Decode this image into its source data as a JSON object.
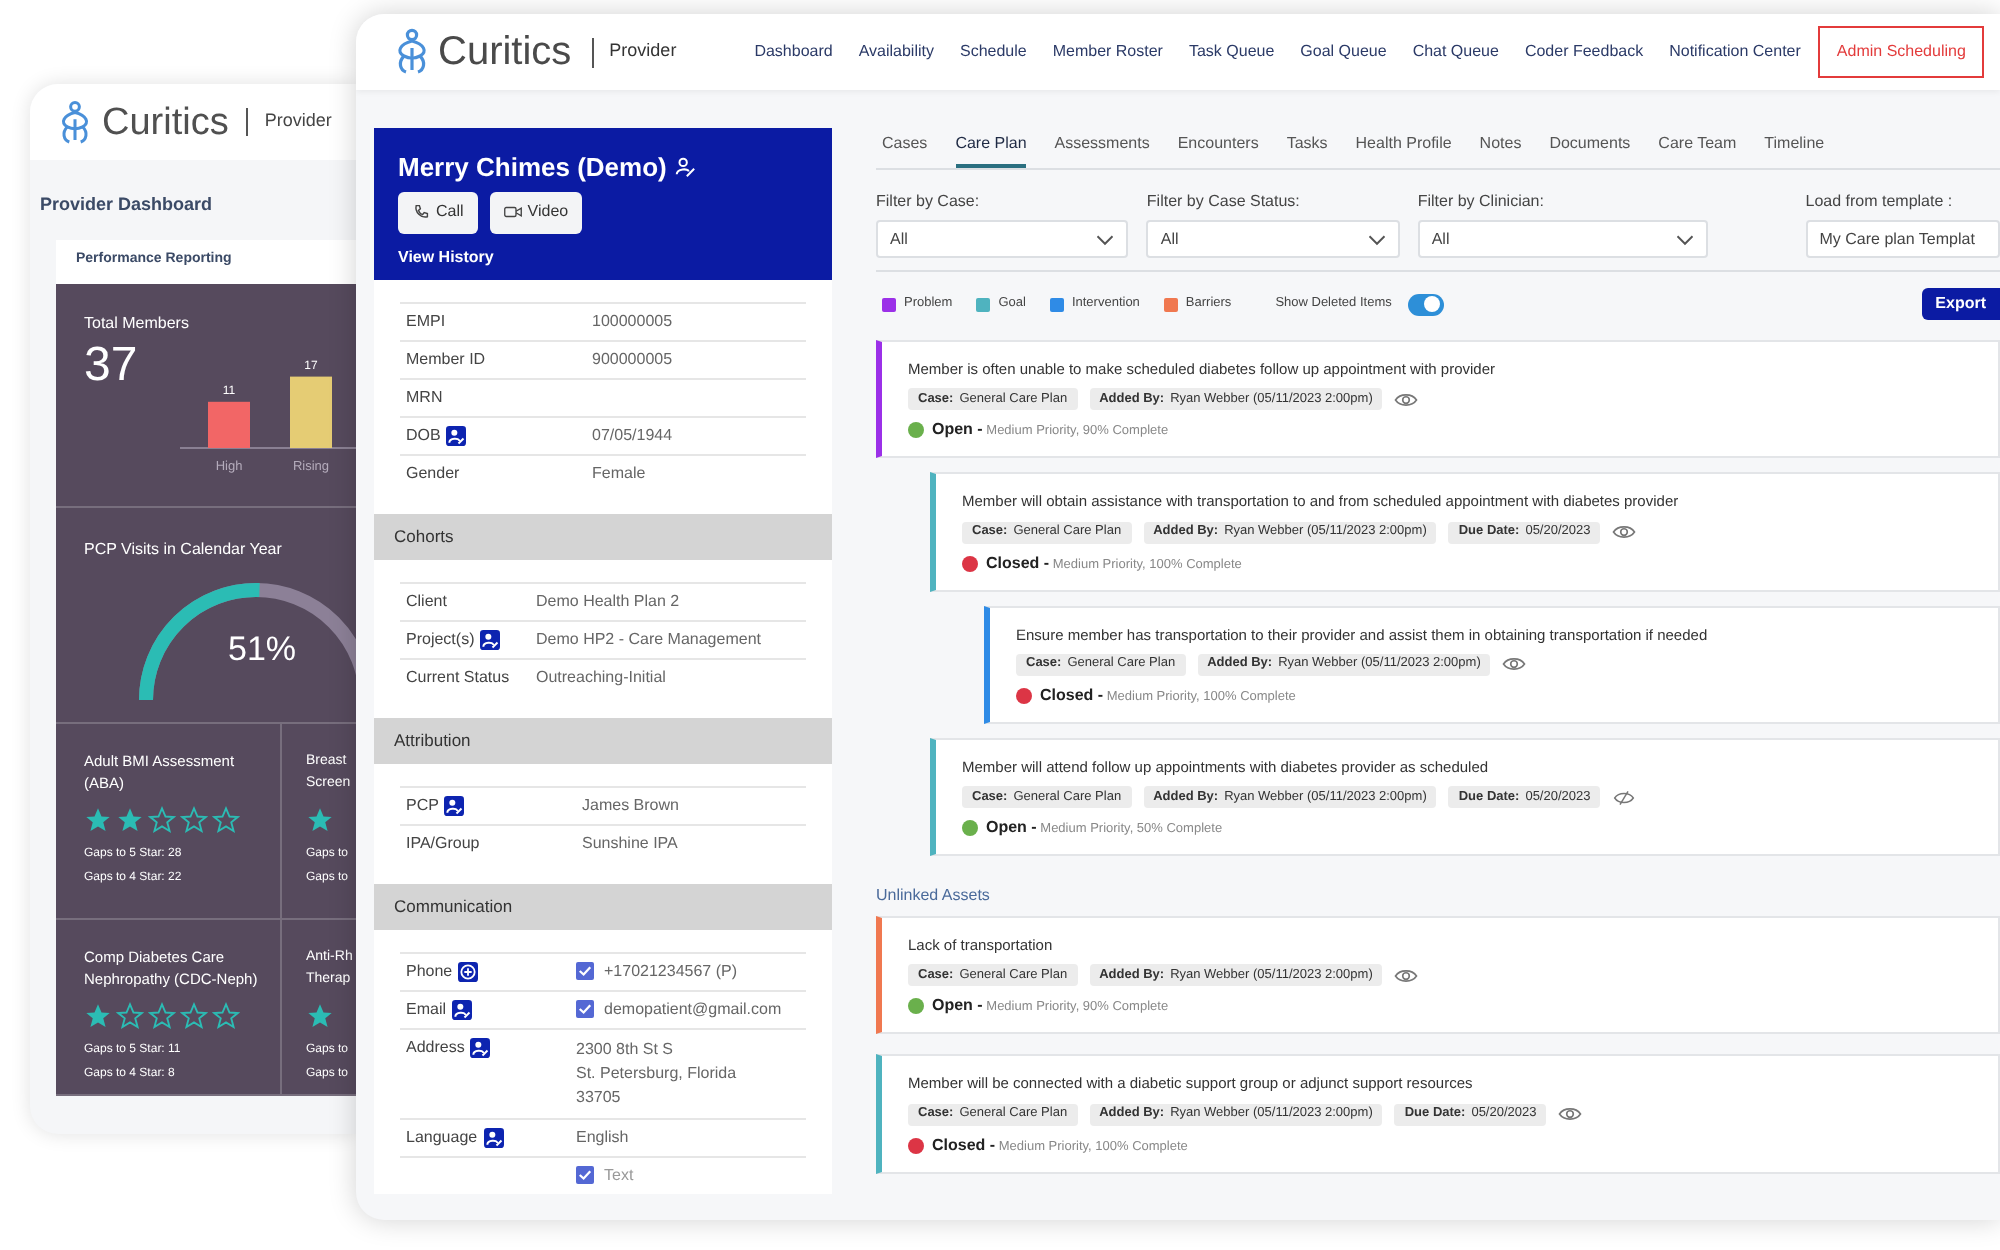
{
  "back_window": {
    "brand": "Curitics",
    "product": "Provider",
    "page_title": "Provider Dashboard",
    "card_title": "Performance Reporting",
    "total_members": {
      "label": "Total Members",
      "value": "37",
      "chart_data": {
        "type": "bar",
        "categories": [
          "High",
          "Rising"
        ],
        "values": [
          11,
          17
        ],
        "data_labels": true
      }
    },
    "pcp_visits": {
      "label": "PCP Visits in Calendar Year",
      "level": 0.51,
      "reading": "51%"
    },
    "measures": [
      {
        "kind": "full",
        "title": "Adult BMI Assessment (ABA)",
        "stars": 2,
        "gaps": [
          "Gaps to 5 Star: 28",
          "Gaps to 4 Star: 22"
        ]
      },
      {
        "kind": "cut",
        "title": "Breast Screen",
        "gaps": [
          "Gaps to",
          "Gaps to"
        ]
      },
      {
        "kind": "full",
        "title": "Comp Diabetes Care Nephropathy (CDC-Neph)",
        "stars": 1,
        "gaps": [
          "Gaps to 5 Star: 11",
          "Gaps to 4 Star: 8"
        ]
      },
      {
        "kind": "cut",
        "title": "Anti-Rh Therap",
        "gaps": [
          "Gaps to",
          "Gaps to"
        ]
      }
    ]
  },
  "header": {
    "brand": "Curitics",
    "product": "Provider",
    "nav": [
      {
        "label": "Dashboard",
        "kind": "link"
      },
      {
        "label": "Availability",
        "kind": "link"
      },
      {
        "label": "Schedule",
        "kind": "link"
      },
      {
        "label": "Member Roster",
        "kind": "link"
      },
      {
        "label": "Task Queue",
        "kind": "link"
      },
      {
        "label": "Goal Queue",
        "kind": "link"
      },
      {
        "label": "Chat Queue",
        "kind": "link"
      },
      {
        "label": "Coder Feedback",
        "kind": "link"
      },
      {
        "label": "Notification Center",
        "kind": "link"
      },
      {
        "label": "Admin Scheduling",
        "kind": "highlight"
      }
    ]
  },
  "patient": {
    "name": "Merry Chimes (Demo)",
    "buttons": [
      {
        "kind": "call",
        "label": "Call"
      },
      {
        "kind": "video",
        "label": "Video"
      }
    ],
    "link": "View History",
    "sections": [
      {
        "rows": [
          {
            "kind": "plain",
            "label": "EMPI",
            "value": "100000005"
          },
          {
            "kind": "plain",
            "label": "Member ID",
            "value": "900000005"
          },
          {
            "kind": "plain",
            "label": "MRN"
          },
          {
            "kind": "edit",
            "label": "DOB",
            "value": "07/05/1944"
          },
          {
            "kind": "plain",
            "label": "Gender",
            "value": "Female"
          }
        ]
      },
      {
        "heading": "Cohorts",
        "rows": [
          {
            "kind": "plain",
            "label": "Client",
            "value": "Demo Health Plan 2"
          },
          {
            "kind": "edit",
            "label": "Project(s)",
            "value": "Demo HP2 - Care Management"
          },
          {
            "kind": "plain",
            "label": "Current Status",
            "value": "Outreaching-Initial"
          }
        ]
      },
      {
        "heading": "Attribution",
        "rows": [
          {
            "kind": "edit",
            "label": "PCP",
            "value": "James Brown"
          },
          {
            "kind": "plain",
            "label": "IPA/Group",
            "value": "Sunshine IPA"
          }
        ]
      },
      {
        "heading": "Communication",
        "rows": [
          {
            "kind": "add",
            "label": "Phone",
            "checked": true,
            "value": "+17021234567 (P)"
          },
          {
            "kind": "edit",
            "label": "Email",
            "checked": true,
            "value": "demopatient@gmail.com"
          },
          {
            "kind": "edit",
            "label": "Address",
            "lines": [
              "2300 8th St S",
              "St. Petersburg, Florida",
              "33705"
            ]
          },
          {
            "kind": "edit",
            "label": "Language",
            "value": "English"
          },
          {
            "kind": "plain",
            "checked": true,
            "value": "Text"
          }
        ]
      }
    ]
  },
  "tabs": [
    {
      "label": "Cases",
      "selected": false
    },
    {
      "label": "Care Plan",
      "selected": true
    },
    {
      "label": "Assessments",
      "selected": false
    },
    {
      "label": "Encounters",
      "selected": false
    },
    {
      "label": "Tasks",
      "selected": false
    },
    {
      "label": "Health Profile",
      "selected": false
    },
    {
      "label": "Notes",
      "selected": false
    },
    {
      "label": "Documents",
      "selected": false
    },
    {
      "label": "Care Team",
      "selected": false
    },
    {
      "label": "Timeline",
      "selected": false
    }
  ],
  "filters": [
    {
      "label": "Filter by Case:",
      "value": "All"
    },
    {
      "label": "Filter by Case Status:",
      "value": "All"
    },
    {
      "label": "Filter by Clinician:",
      "value": "All"
    }
  ],
  "template": {
    "label": "Load from template :",
    "value": "My Care plan Templat"
  },
  "care_plan": {
    "legend": [
      {
        "kind": "problem",
        "label": "Problem",
        "color": "#9b30e8"
      },
      {
        "kind": "goal",
        "label": "Goal",
        "color": "#4fb3bf"
      },
      {
        "kind": "intervention",
        "label": "Intervention",
        "color": "#2f8be6"
      },
      {
        "kind": "barrier",
        "label": "Barriers",
        "color": "#f07850"
      }
    ],
    "show_deleted": {
      "label": "Show Deleted Items",
      "on": true
    },
    "export": "Export",
    "items": [
      {
        "kind": "problem",
        "title": "Member is often unable to make scheduled diabetes follow up appointment with provider",
        "chips": [
          "**Case:** General Care Plan",
          "**Added By:** Ryan Webber (05/11/2023 2:00pm)"
        ],
        "visible": true,
        "open": true,
        "status": "**Open -** Medium Priority, 90% Complete",
        "children": [
          {
            "kind": "goal",
            "title": "Member will obtain assistance with transportation to and from scheduled appointment with diabetes provider",
            "chips": [
              "**Case:** General Care Plan",
              "**Added By:** Ryan Webber (05/11/2023 2:00pm)",
              "**Due Date:** 05/20/2023"
            ],
            "visible": true,
            "open": false,
            "status": "**Closed -** Medium Priority, 100% Complete",
            "children": [
              {
                "kind": "intervention",
                "title": "Ensure member has transportation to their provider and assist them in obtaining transportation if needed",
                "chips": [
                  "**Case:** General Care Plan",
                  "**Added By:** Ryan Webber (05/11/2023 2:00pm)"
                ],
                "visible": true,
                "open": false,
                "status": "**Closed -** Medium Priority, 100% Complete"
              }
            ]
          },
          {
            "kind": "goal",
            "title": "Member will attend follow up appointments with diabetes provider as scheduled",
            "chips": [
              "**Case:** General Care Plan",
              "**Added By:** Ryan Webber (05/11/2023 2:00pm)",
              "**Due Date:** 05/20/2023"
            ],
            "visible": false,
            "open": true,
            "status": "**Open -** Medium Priority, 50% Complete"
          }
        ]
      }
    ],
    "unlinked_heading": "Unlinked Assets",
    "unlinked": [
      {
        "kind": "barrier",
        "title": "Lack of transportation",
        "chips": [
          "**Case:** General Care Plan",
          "**Added By:** Ryan Webber (05/11/2023 2:00pm)"
        ],
        "visible": true,
        "open": true,
        "status": "**Open -** Medium Priority, 90% Complete"
      },
      {
        "kind": "goal",
        "title": "Member will be connected with a diabetic support group or adjunct support resources",
        "chips": [
          "**Case:** General Care Plan",
          "**Added By:** Ryan Webber (05/11/2023 2:00pm)",
          "**Due Date:** 05/20/2023"
        ],
        "visible": true,
        "open": false,
        "status": "**Closed -** Medium Priority, 100% Complete"
      }
    ]
  }
}
